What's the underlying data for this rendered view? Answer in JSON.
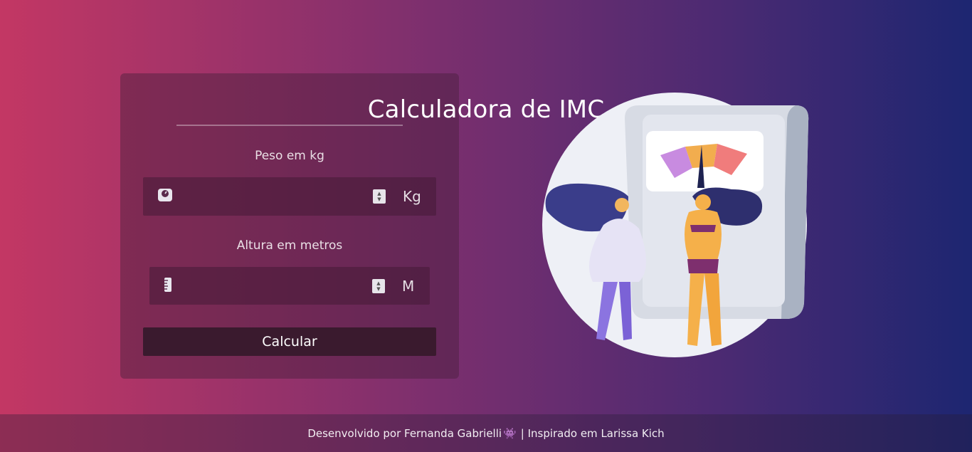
{
  "app": {
    "title": "Calculadora de IMC"
  },
  "form": {
    "weight": {
      "label": "Peso em kg",
      "value": "",
      "placeholder": "",
      "unit": "Kg",
      "icon": "scale-icon"
    },
    "height": {
      "label": "Altura em metros",
      "value": "",
      "placeholder": "",
      "unit": "M",
      "icon": "ruler-icon"
    },
    "submit_label": "Calcular"
  },
  "footer": {
    "left_text": "Desenvolvido por Fernanda Gabrielli",
    "emoji": "👾",
    "right_text": "| Inspirado em Larissa Kich"
  },
  "colors": {
    "gradient_start": "#c33764",
    "gradient_end": "#1d2671",
    "button_bg": "#3a1a2e"
  }
}
